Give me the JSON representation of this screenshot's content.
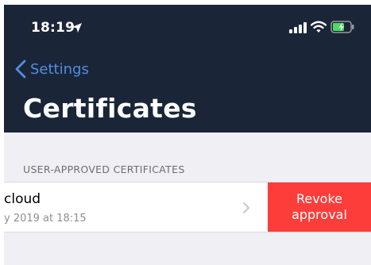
{
  "status_bar": {
    "time": "18:19",
    "location_icon": "location-arrow-icon",
    "signal_icon": "cellular-signal-icon",
    "wifi_icon": "wifi-icon",
    "battery_icon": "battery-charging-icon"
  },
  "nav": {
    "back_label": "Settings",
    "title": "Certificates"
  },
  "section": {
    "header": "USER-APPROVED CERTIFICATES",
    "items": [
      {
        "title": "cloud",
        "subtitle": "y 2019 at 18:15",
        "action_line1": "Revoke",
        "action_line2": "approval"
      }
    ]
  },
  "colors": {
    "nav_background": "#1b2538",
    "accent": "#4e8fe0",
    "destructive": "#fc3d39",
    "battery_charge": "#4cd964"
  }
}
